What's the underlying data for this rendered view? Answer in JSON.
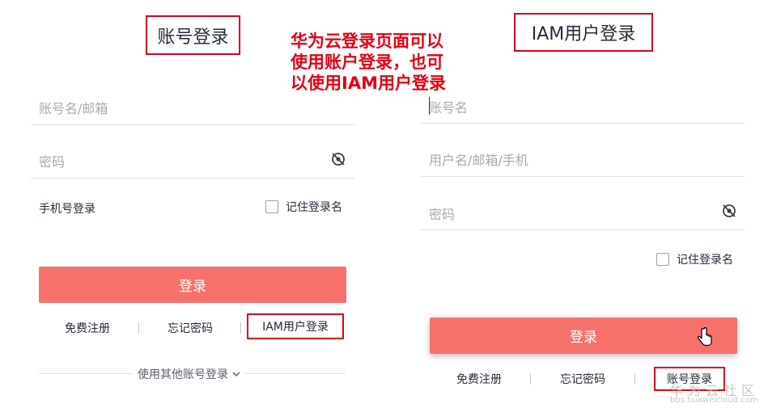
{
  "left_panel": {
    "title": "账号登录",
    "username_placeholder": "账号名/邮箱",
    "password_placeholder": "密码",
    "password_visibility_icon": "eye-off-icon",
    "phone_login": "手机号登录",
    "remember_label": "记住登录名",
    "login_button": "登录",
    "register_link": "免费注册",
    "forgot_link": "忘记密码",
    "iam_link": "IAM用户登录",
    "other_login": "使用其他账号登录",
    "other_login_icon": "chevron-down-icon"
  },
  "annotation": {
    "lines": [
      "华为云登录页面可以",
      "使用账户登录，也可",
      "以使用IAM用户登录"
    ],
    "color": "#e60012"
  },
  "right_panel": {
    "title": "IAM用户登录",
    "account_placeholder": "账号名",
    "user_placeholder": "用户名/邮箱/手机",
    "password_placeholder": "密码",
    "password_visibility_icon": "eye-off-icon",
    "remember_label": "记住登录名",
    "login_button": "登录",
    "register_link": "免费注册",
    "forgot_link": "忘记密码",
    "account_link": "账号登录",
    "cursor_icon": "hand-pointer-icon"
  },
  "watermark": {
    "text": "华为云社区",
    "url": "bbs.huaweicloud.com"
  },
  "colors": {
    "accent": "#f6716c",
    "highlight_border": "#d9001b"
  }
}
